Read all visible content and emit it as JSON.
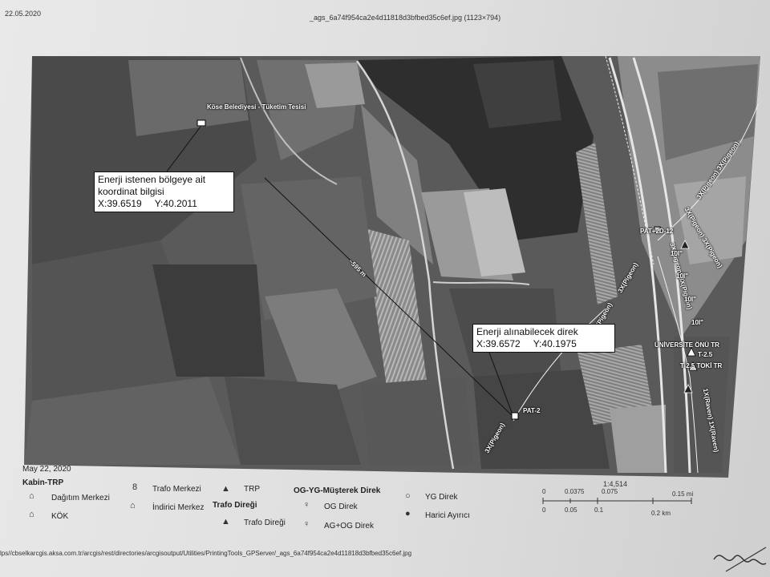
{
  "header": {
    "date": "22.05.2020",
    "title": "_ags_6a74f954ca2e4d11818d3bfbed35c6ef.jpg (1123×794)"
  },
  "map": {
    "facility_label": "Köse Belediyesi - Tüketim Tesisi",
    "distance_label": "~595 m",
    "pat2_label": "PAT-2",
    "pat2d12_label": "PAT+2D-12",
    "road_labels": [
      "3X(Pigeon) 3X(Pigeon)",
      "3X(Pigeon)",
      "3X(Pigeon)",
      "3X(Pigeon)",
      "3X(Pigeon) 3X(Pigeon)",
      "1X(Raven) 1X(Raven)",
      "3X(Pigeon) 3X(Pigeon)"
    ],
    "pole_labels": [
      "10I\"",
      "10I\"",
      "10I\"",
      "10I\""
    ],
    "station_labels": [
      "ÜNİVERSİTE ÖNÜ TR",
      "T-2.5",
      "T-2.5 TOKİ TR"
    ],
    "callout_request": {
      "line1": "Enerji istenen bölgeye ait",
      "line2": "koordinat bilgisi",
      "x": "X:39.6519",
      "y": "Y:40.2011"
    },
    "callout_available": {
      "line1": "Enerji alınabilecek direk",
      "x": "X:39.6572",
      "y": "Y:40.1975"
    }
  },
  "legend": {
    "date": "May 22, 2020",
    "kabin_title": "Kabin-TRP",
    "dagitim": "Dağıtım Merkezi",
    "kok": "KÖK",
    "trafo_merkezi": "Trafo Merkezi",
    "indirici": "İndirici Merkez",
    "trafo_diregi_title": "Trafo Direği",
    "trp": "TRP",
    "trafo_diregi": "Trafo Direği",
    "og_yg_title": "OG-YG-Müşterek Direk",
    "og_direk": "OG Direk",
    "ag_og_direk": "AG+OG Direk",
    "yg_direk": "YG Direk",
    "harici": "Harici Ayırıcı"
  },
  "scale": {
    "ratio": "1:4,514",
    "top_ticks": [
      "0",
      "0.0375",
      "0.075",
      "0.15 mi"
    ],
    "bottom_ticks": [
      "0",
      "0.05",
      "0.1",
      "0.2 km"
    ]
  },
  "footer": {
    "url": "lps//cbselkarcgis.aksa.com.tr/arcgis/rest/directories/arcgisoutput/Utilities/PrintingTools_GPServer/_ags_6a74f954ca2e4d11818d3bfbed35c6ef.jpg"
  }
}
